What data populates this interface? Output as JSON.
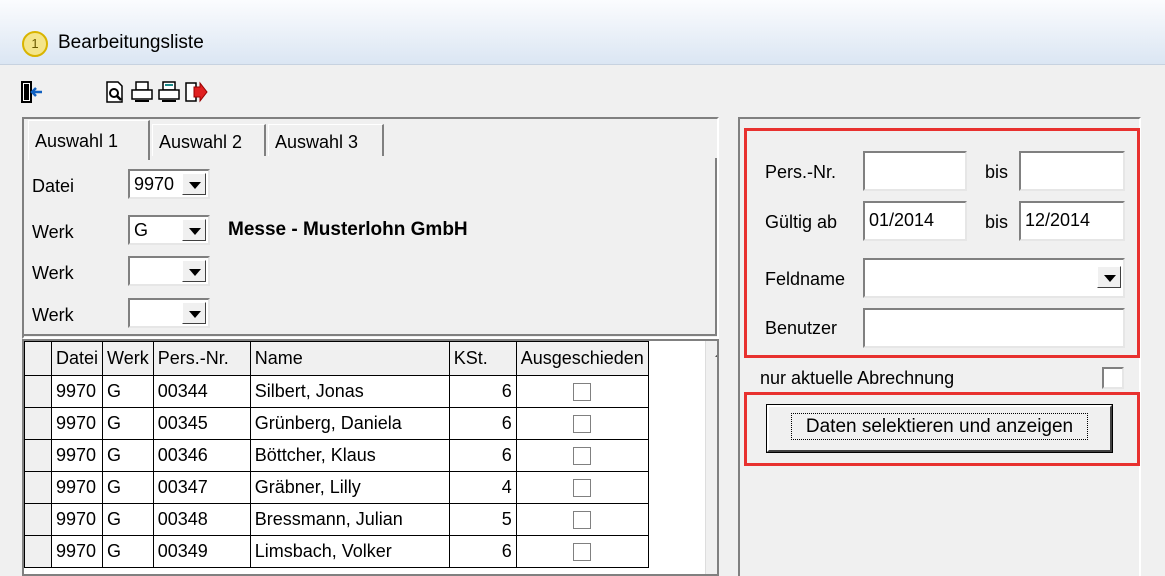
{
  "window": {
    "title": "Bearbeitungsliste",
    "icon_number": "1"
  },
  "toolbar": [
    "exit-icon",
    "preview-icon",
    "print-icon",
    "print-setup-icon",
    "export-icon"
  ],
  "tabs": [
    "Auswahl 1",
    "Auswahl 2",
    "Auswahl 3"
  ],
  "auswahl1": {
    "datei_label": "Datei",
    "datei_value": "9970",
    "werk_label": "Werk",
    "werk1_value": "G",
    "werk2_value": "",
    "werk3_value": "",
    "firm_name": "Messe - Musterlohn GmbH"
  },
  "grid": {
    "columns": [
      "Datei",
      "Werk",
      "Pers.-Nr.",
      "Name",
      "KSt.",
      "Ausgeschieden"
    ],
    "rows": [
      {
        "datei": "9970",
        "werk": "G",
        "persnr": "00344",
        "name": "Silbert, Jonas",
        "kst": "6"
      },
      {
        "datei": "9970",
        "werk": "G",
        "persnr": "00345",
        "name": "Grünberg, Daniela",
        "kst": "6"
      },
      {
        "datei": "9970",
        "werk": "G",
        "persnr": "00346",
        "name": "Böttcher, Klaus",
        "kst": "6"
      },
      {
        "datei": "9970",
        "werk": "G",
        "persnr": "00347",
        "name": "Gräbner, Lilly",
        "kst": "4"
      },
      {
        "datei": "9970",
        "werk": "G",
        "persnr": "00348",
        "name": "Bressmann, Julian",
        "kst": "5"
      },
      {
        "datei": "9970",
        "werk": "G",
        "persnr": "00349",
        "name": "Limsbach, Volker",
        "kst": "6"
      }
    ]
  },
  "filter": {
    "pers_label": "Pers.-Nr.",
    "bis_label": "bis",
    "pers_from": "",
    "pers_to": "",
    "gueltig_label": "Gültig ab",
    "gueltig_from": "01/2014",
    "gueltig_to": "12/2014",
    "feldname_label": "Feldname",
    "feldname_value": "",
    "benutzer_label": "Benutzer",
    "benutzer_value": "",
    "aktuelle_label": "nur aktuelle Abrechnung",
    "button_label": "Daten selektieren und anzeigen"
  },
  "colors": {
    "highlight": "#e8312f"
  }
}
